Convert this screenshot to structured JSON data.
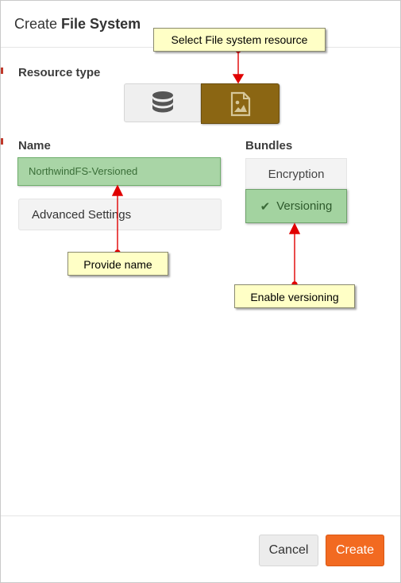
{
  "dialog": {
    "title_prefix": "Create",
    "title_bold": "File System"
  },
  "resource_type": {
    "label": "Resource type",
    "options": [
      {
        "icon": "database-icon",
        "selected": false
      },
      {
        "icon": "file-image-icon",
        "selected": true
      }
    ]
  },
  "name": {
    "label": "Name",
    "value": "NorthwindFS-Versioned"
  },
  "advanced_settings": {
    "label": "Advanced Settings"
  },
  "bundles": {
    "label": "Bundles",
    "items": [
      {
        "label": "Encryption",
        "selected": false
      },
      {
        "label": "Versioning",
        "selected": true
      }
    ]
  },
  "callouts": {
    "select_resource": "Select File system resource",
    "provide_name": "Provide name",
    "enable_versioning": "Enable versioning"
  },
  "footer": {
    "cancel_label": "Cancel",
    "create_label": "Create"
  },
  "colors": {
    "accent": "#f26a21",
    "selected_resource": "#8b6613",
    "highlight_green": "#a9d5a6",
    "callout_bg": "#ffffc6",
    "arrow_red": "#e00000"
  }
}
